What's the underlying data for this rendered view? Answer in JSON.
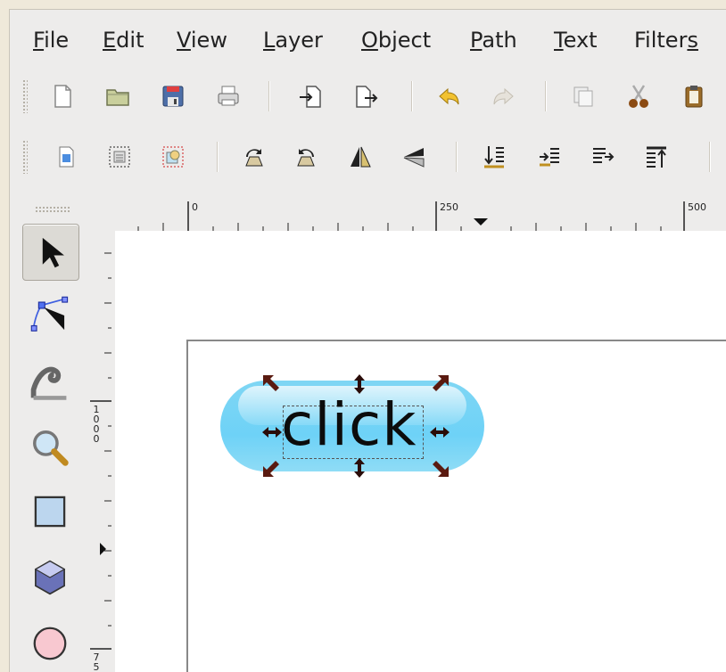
{
  "menu": {
    "file": "File",
    "file_rest": "ile",
    "edit": "Edit",
    "edit_rest": "dit",
    "view": "View",
    "view_rest": "iew",
    "layer": "Layer",
    "layer_rest": "ayer",
    "object": "Object",
    "object_rest": "bject",
    "path": "Path",
    "path_rest": "ath",
    "text": "Text",
    "text_rest": "ext",
    "filters": "Filters",
    "filters_rest": "Filter"
  },
  "ruler": {
    "h_labels": [
      "0",
      "250",
      "500"
    ],
    "v_label_top": "1\n0\n0\n0",
    "v_label_bottom": "7\n5"
  },
  "canvas": {
    "button_text": "click"
  },
  "colors": {
    "pill": "#6ed2f7",
    "handle": "#5a1a10"
  }
}
